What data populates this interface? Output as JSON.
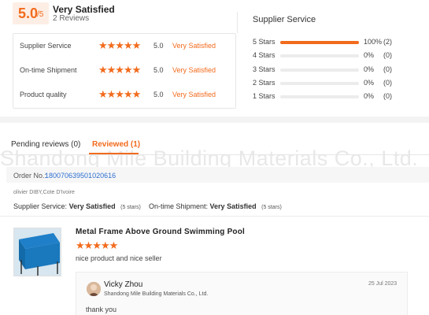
{
  "summary": {
    "score": "5.0",
    "score_den": "/5",
    "rating_title": "Very Satisfied",
    "review_count": "2 Reviews"
  },
  "criteria": [
    {
      "label": "Supplier Service",
      "stars": "★★★★★",
      "value": "5.0",
      "satisfaction": "Very Satisfied"
    },
    {
      "label": "On-time Shipment",
      "stars": "★★★★★",
      "value": "5.0",
      "satisfaction": "Very Satisfied"
    },
    {
      "label": "Product quality",
      "stars": "★★★★★",
      "value": "5.0",
      "satisfaction": "Very Satisfied"
    }
  ],
  "distribution": {
    "title": "Supplier Service",
    "rows": [
      {
        "label": "5  Stars",
        "fraction": 1.0,
        "pct": "100%",
        "count": "(2)"
      },
      {
        "label": "4  Stars",
        "fraction": 0.0,
        "pct": "0%",
        "count": "(0)"
      },
      {
        "label": "3  Stars",
        "fraction": 0.0,
        "pct": "0%",
        "count": "(0)"
      },
      {
        "label": "2  Stars",
        "fraction": 0.0,
        "pct": "0%",
        "count": "(0)"
      },
      {
        "label": "1  Stars",
        "fraction": 0.0,
        "pct": "0%",
        "count": "(0)"
      }
    ]
  },
  "tabs": [
    {
      "label": "Pending reviews (0)",
      "active": false
    },
    {
      "label": "Reviewed (1)",
      "active": true
    }
  ],
  "watermark": "Shandong Mile Building Materials Co., Ltd.",
  "order": {
    "label": "Order No.:",
    "number": "180070639501020616"
  },
  "buyer": "olivier DIBY,Cote D'Ivoire",
  "service_ratings": {
    "supplier_label": "Supplier Service:",
    "supplier_value": "Very Satisfied",
    "supplier_stars": "(5 stars)",
    "shipment_label": "On-time Shipment:",
    "shipment_value": "Very Satisfied",
    "shipment_stars": "(5 stars)"
  },
  "product": {
    "title": "Metal Frame Above Ground Swimming Pool",
    "stars": "★★★★★",
    "comment": "nice product and nice seller"
  },
  "reply": {
    "name": "Vicky Zhou",
    "company": "Shandong Mile Building Materials Co., Ltd.",
    "date": "25 Jul 2023",
    "text": "thank you"
  },
  "colors": {
    "accent": "#f26b1d",
    "link": "#2e6fd1"
  }
}
